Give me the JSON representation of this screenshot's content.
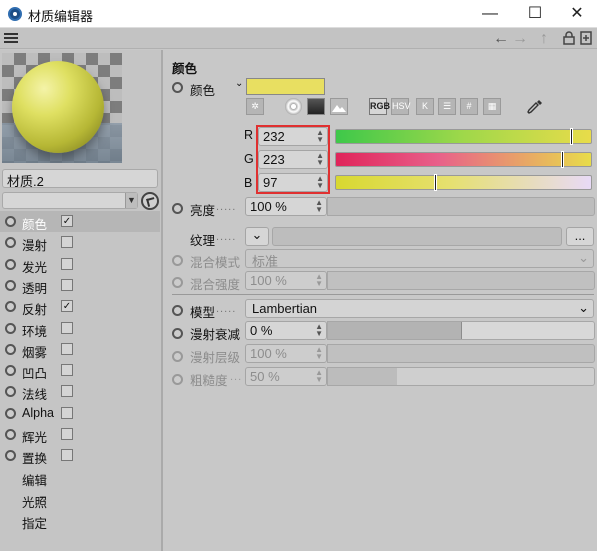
{
  "window": {
    "title": "材质编辑器",
    "minimize": "—",
    "maximize": "☐",
    "close": "✕"
  },
  "material_name": "材质.2",
  "channels": [
    {
      "label": "颜色",
      "checked": true,
      "selected": true
    },
    {
      "label": "漫射",
      "checked": false
    },
    {
      "label": "发光",
      "checked": false
    },
    {
      "label": "透明",
      "checked": false
    },
    {
      "label": "反射",
      "checked": true
    },
    {
      "label": "环境",
      "checked": false
    },
    {
      "label": "烟雾",
      "checked": false
    },
    {
      "label": "凹凸",
      "checked": false
    },
    {
      "label": "法线",
      "checked": false
    },
    {
      "label": "Alpha",
      "checked": false
    },
    {
      "label": "辉光",
      "checked": false
    },
    {
      "label": "置换",
      "checked": false
    }
  ],
  "extra_items": [
    "编辑",
    "光照",
    "指定"
  ],
  "section_title": "颜色",
  "color": {
    "label": "颜色",
    "swatch_hex": "#e8df61",
    "mode_buttons": [
      "RGB",
      "HSV",
      "K",
      "☰",
      "#",
      "▦"
    ],
    "r": {
      "label": "R",
      "value": "232",
      "fraction": 0.91
    },
    "g": {
      "label": "G",
      "value": "223",
      "fraction": 0.874
    },
    "b": {
      "label": "B",
      "value": "97",
      "fraction": 0.38
    }
  },
  "brightness": {
    "label": "亮度",
    "value": "100 %"
  },
  "texture": {
    "label": "纹理",
    "button": "...",
    "dropdown": "⌄"
  },
  "blend_mode": {
    "label": "混合模式",
    "value": "标准"
  },
  "blend_strength": {
    "label": "混合强度",
    "value": "100 %"
  },
  "model": {
    "label": "模型",
    "value": "Lambertian"
  },
  "diffuse_falloff": {
    "label": "漫射衰减",
    "value": "0 %"
  },
  "diffuse_level": {
    "label": "漫射层级",
    "value": "100 %"
  },
  "roughness": {
    "label": "粗糙度",
    "value": "50 %",
    "fraction": 0.26
  },
  "nav": {
    "back": "←",
    "forward": "→",
    "up": "↑",
    "lock": "🔒",
    "new": "⊞"
  }
}
